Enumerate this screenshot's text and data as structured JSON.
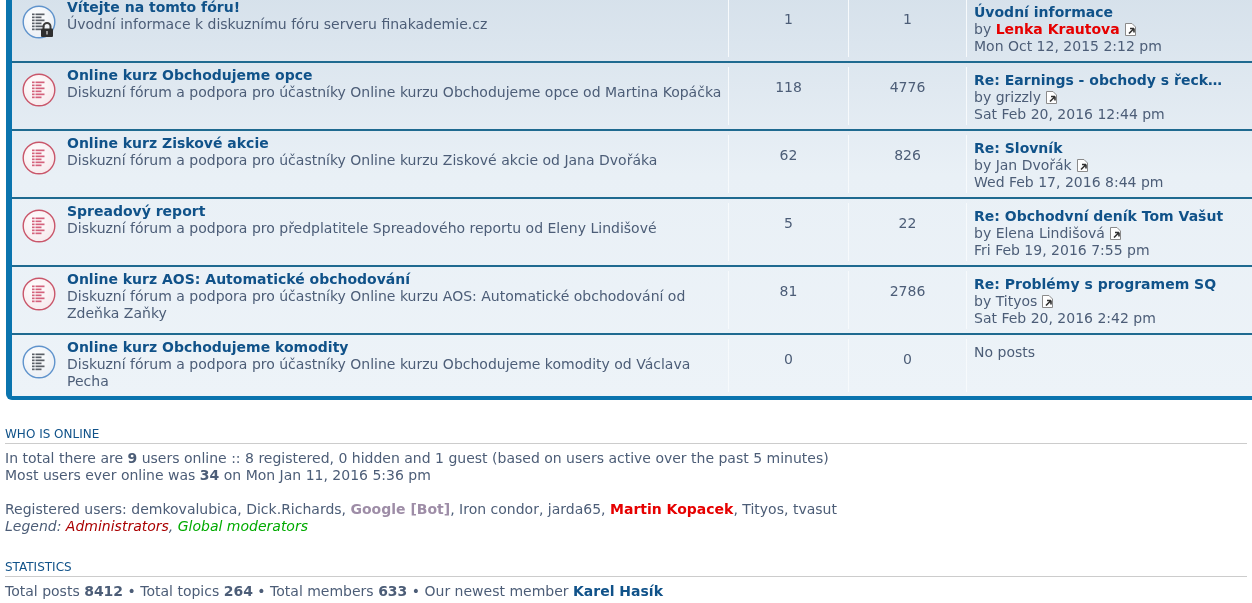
{
  "forums": [
    {
      "title": "Vítejte na tomto fóru!",
      "description": "Úvodní informace k diskuznímu fóru serveru finakademie.cz",
      "unread": false,
      "locked": true,
      "topics": "1",
      "posts": "1",
      "last_post": {
        "kind": "post",
        "title": "Úvodní informace",
        "by": "by",
        "author": {
          "name": "Lenka Krautova",
          "kind": "admin"
        },
        "date": "Mon Oct 12, 2015 2:12 pm"
      }
    },
    {
      "title": "Online kurz Obchodujeme opce",
      "description": "Diskuzní fórum a podpora pro účastníky Online kurzu Obchodujeme opce od Martina Kopáčka",
      "unread": true,
      "locked": false,
      "topics": "118",
      "posts": "4776",
      "last_post": {
        "kind": "post",
        "title": "Re: Earnings - obchody s řeck…",
        "by": "by",
        "author": {
          "name": "grizzly",
          "kind": "user"
        },
        "date": "Sat Feb 20, 2016 12:44 pm"
      }
    },
    {
      "title": "Online kurz Ziskové akcie",
      "description": "Diskuzní fórum a podpora pro účastníky Online kurzu Ziskové akcie od Jana Dvořáka",
      "unread": true,
      "locked": false,
      "topics": "62",
      "posts": "826",
      "last_post": {
        "kind": "post",
        "title": "Re: Slovník",
        "by": "by",
        "author": {
          "name": "Jan Dvořák",
          "kind": "user"
        },
        "date": "Wed Feb 17, 2016 8:44 pm"
      }
    },
    {
      "title": "Spreadový report",
      "description": "Diskuzní fórum a podpora pro předplatitele Spreadového reportu od Eleny Lindišové",
      "unread": true,
      "locked": false,
      "topics": "5",
      "posts": "22",
      "last_post": {
        "kind": "post",
        "title": "Re: Obchodvní deník Tom Vašut",
        "by": "by",
        "author": {
          "name": "Elena Lindišová",
          "kind": "user"
        },
        "date": "Fri Feb 19, 2016 7:55 pm"
      }
    },
    {
      "title": "Online kurz AOS: Automatické obchodování",
      "description": "Diskuzní fórum a podpora pro účastníky Online kurzu AOS: Automatické obchodování od Zdeňka Zaňky",
      "unread": true,
      "locked": false,
      "topics": "81",
      "posts": "2786",
      "last_post": {
        "kind": "post",
        "title": "Re: Problémy s programem SQ",
        "by": "by",
        "author": {
          "name": "Tityos",
          "kind": "user"
        },
        "date": "Sat Feb 20, 2016 2:42 pm"
      }
    },
    {
      "title": "Online kurz Obchodujeme komodity",
      "description": "Diskuzní fórum a podpora pro účastníky Online kurzu Obchodujeme komodity od Václava Pecha",
      "unread": false,
      "locked": false,
      "topics": "0",
      "posts": "0",
      "last_post": {
        "kind": "empty",
        "text": "No posts"
      }
    }
  ],
  "who_is_online": {
    "heading": "WHO IS ONLINE",
    "lines": [
      "In total there are **9** users online :: 8 registered, 0 hidden and 1 guest (based on users active over the past 5 minutes)",
      "Most users ever online was **34** on Mon Jan 11, 2016 5:36 pm"
    ],
    "registered": {
      "label": "Registered users:",
      "separator": ",",
      "users": [
        {
          "name": "demkovalubica",
          "kind": "user"
        },
        {
          "name": "Dick.Richards",
          "kind": "user"
        },
        {
          "name": "Google [Bot]",
          "kind": "bot"
        },
        {
          "name": "Iron condor",
          "kind": "user"
        },
        {
          "name": "jarda65",
          "kind": "user"
        },
        {
          "name": "Martin Kopacek",
          "kind": "admin"
        },
        {
          "name": "Tityos",
          "kind": "user"
        },
        {
          "name": "tvasut",
          "kind": "user"
        }
      ]
    },
    "legend": {
      "label": "Legend:",
      "separator": ",",
      "groups": [
        {
          "name": "Administrators",
          "color": "#aa0000"
        },
        {
          "name": "Global moderators",
          "color": "#00aa00"
        }
      ]
    }
  },
  "statistics": {
    "heading": "STATISTICS",
    "text": "Total posts **8412** • Total topics **264** • Total members **633** • Our newest member",
    "newest_member": "Karel Hasík"
  }
}
